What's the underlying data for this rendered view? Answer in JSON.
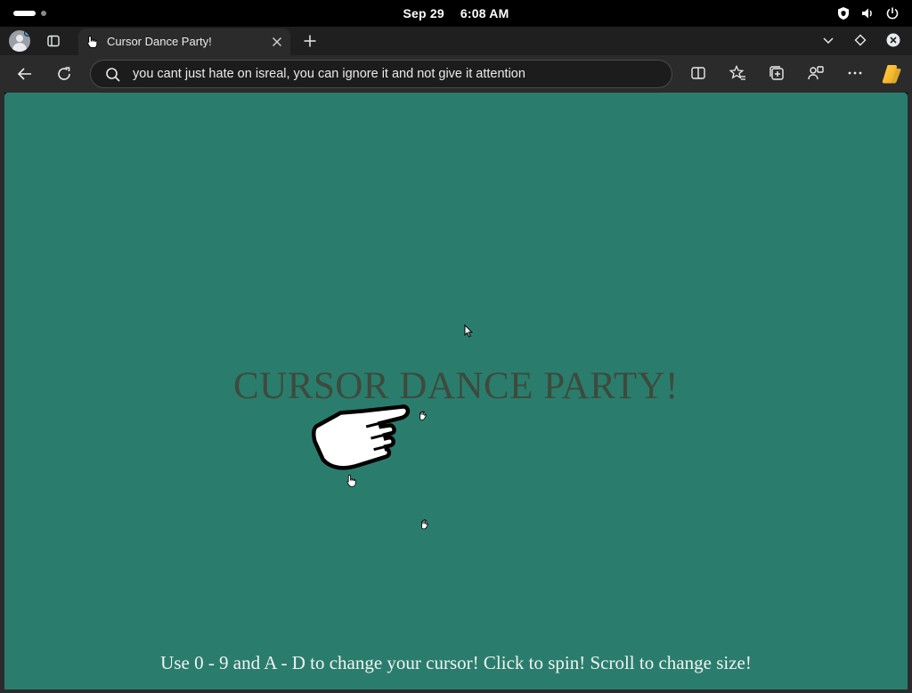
{
  "status_bar": {
    "date": "Sep 29",
    "time": "6:08 AM",
    "icons": [
      "shield-icon",
      "volume-icon",
      "power-icon"
    ]
  },
  "tab_strip": {
    "active_tab": {
      "title": "Cursor Dance Party!",
      "favicon": "hand-cursor-icon"
    },
    "right_icons": [
      "tab-list-chevron-icon",
      "diamond-icon",
      "close-window-icon"
    ]
  },
  "toolbar": {
    "address_text": "you cant just hate on isreal, you can ignore it and not give it attention",
    "right_icons": [
      "split-screen-icon",
      "favorites-star-icon",
      "collections-icon",
      "extensions-icon",
      "more-icon",
      "copilot-icon"
    ]
  },
  "page": {
    "title": "CURSOR DANCE PARTY!",
    "instructions": "Use 0 - 9 and A - D to change your cursor! Click to spin! Scroll to change size!",
    "background": "#2a7d6d",
    "title_color": "#3e4a3c",
    "instructions_color": "#f2f2f2"
  }
}
